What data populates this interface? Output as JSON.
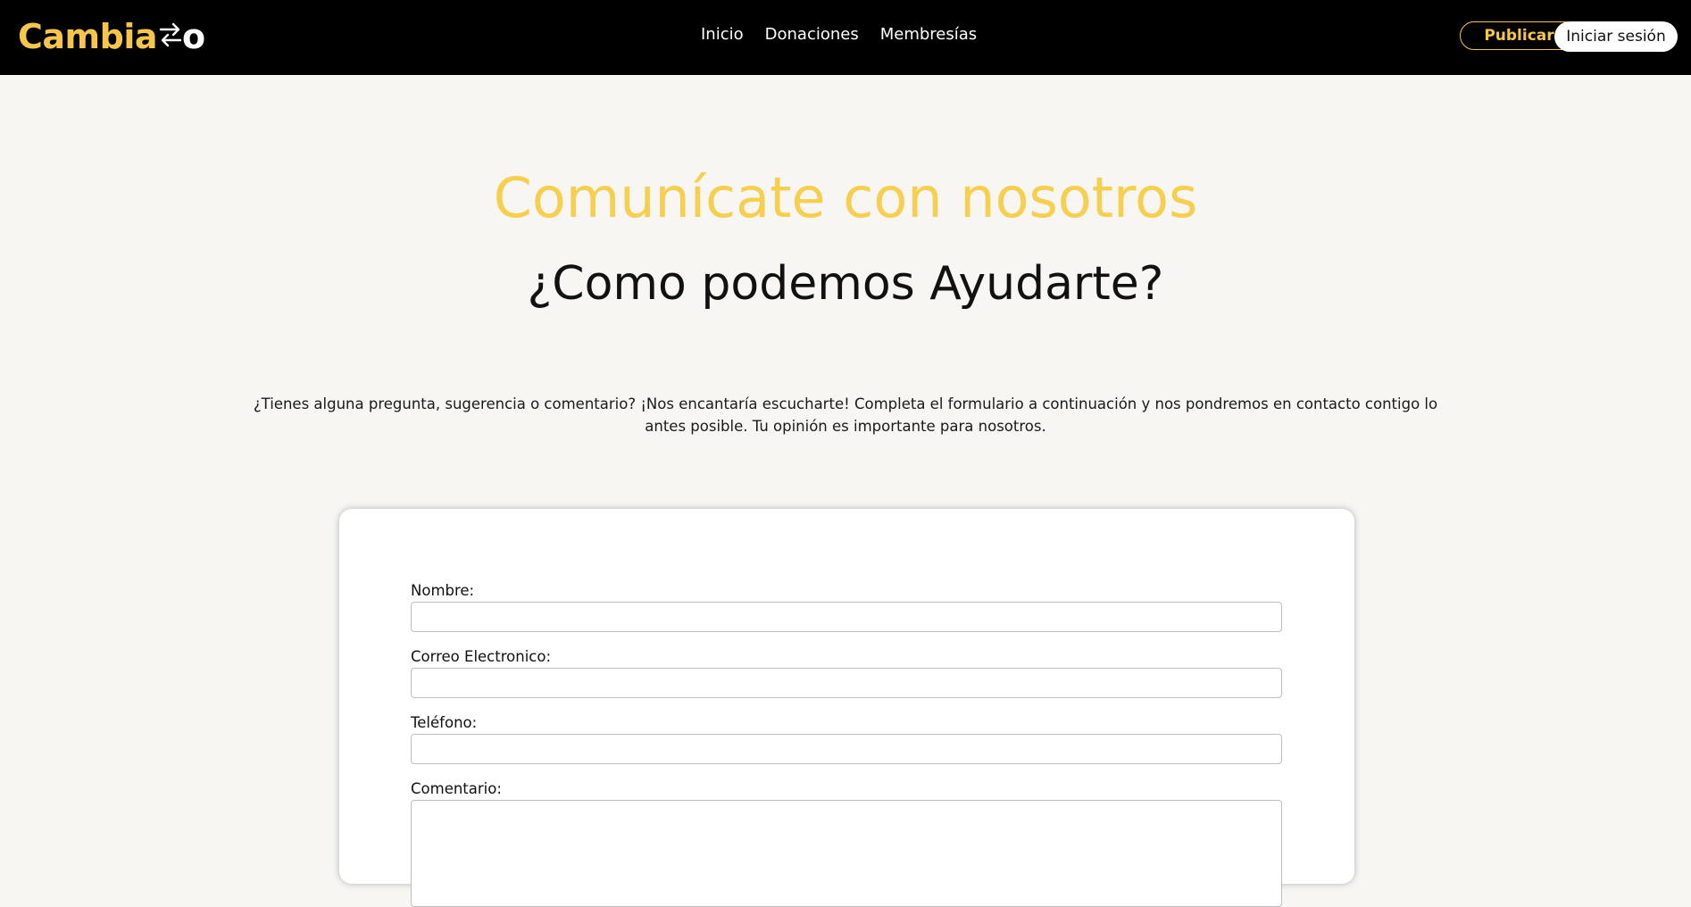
{
  "brand": {
    "logo_text": "Cambia",
    "logo_suffix": "o",
    "accent_color": "#f6c64a"
  },
  "nav": {
    "links": [
      {
        "label": "Inicio"
      },
      {
        "label": "Donaciones"
      },
      {
        "label": "Membresías"
      }
    ],
    "publicar_label": "Publicar",
    "login_label": "Iniciar sesión"
  },
  "hero": {
    "title": "Comunícate con nosotros",
    "subtitle": "¿Como podemos Ayudarte?",
    "intro": "¿Tienes alguna pregunta, sugerencia o comentario? ¡Nos encantaría escucharte! Completa el formulario a continuación y nos pondremos en contacto contigo lo antes posible. Tu opinión es importante para nosotros."
  },
  "form": {
    "nombre_label": "Nombre:",
    "nombre_value": "",
    "correo_label": "Correo Electronico:",
    "correo_value": "",
    "telefono_label": "Teléfono:",
    "telefono_value": "",
    "comentario_label": "Comentario:",
    "comentario_value": ""
  }
}
